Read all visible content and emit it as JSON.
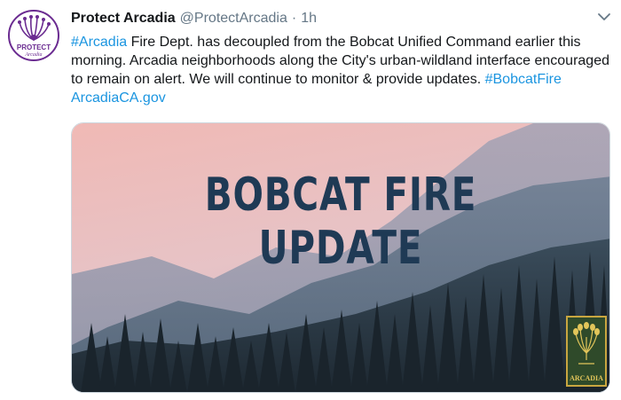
{
  "tweet": {
    "author_name": "Protect Arcadia",
    "handle": "@ProtectArcadia",
    "separator": "·",
    "time": "1h",
    "text_parts": [
      {
        "text": "#Arcadia",
        "kind": "link"
      },
      {
        "text": " Fire Dept. has decoupled from the Bobcat Unified Command earlier this morning. Arcadia neighborhoods along the City's urban-wildland interface encouraged to remain on alert. We will continue to monitor & provide updates. ",
        "kind": "text"
      },
      {
        "text": "#BobcatFire",
        "kind": "link"
      },
      {
        "text": " ",
        "kind": "text"
      },
      {
        "text": "ArcadiaCA.gov",
        "kind": "link"
      }
    ]
  },
  "avatar": {
    "top_text": "PROTECT",
    "bottom_text": "Arcadia",
    "color": "#6b2c91"
  },
  "media": {
    "title_line1": "BOBCAT FIRE",
    "title_line2": "UPDATE",
    "seal_text": "ARCADIA",
    "title_color": "#1f3a55"
  },
  "colors": {
    "link": "#1b95e0",
    "secondary_text": "#657786",
    "primary_text": "#14171a"
  },
  "icons": {
    "menu": "chevron-down-icon",
    "avatar": "peacock-logo-icon",
    "seal": "city-seal-icon"
  }
}
